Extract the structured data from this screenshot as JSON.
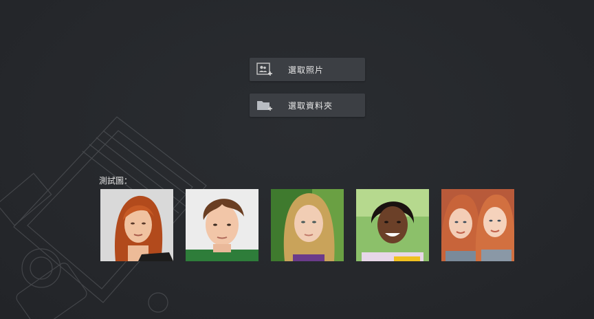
{
  "actions": {
    "select_photos_label": "選取照片",
    "select_folder_label": "選取資料夾"
  },
  "test_images": {
    "label": "測試圖：",
    "items": [
      {
        "icon": "portrait-redhead-woman"
      },
      {
        "icon": "portrait-brown-hair-boy"
      },
      {
        "icon": "portrait-blonde-girl"
      },
      {
        "icon": "portrait-smiling-girl"
      },
      {
        "icon": "portrait-twin-girls"
      }
    ]
  },
  "colors": {
    "background": "#26282c",
    "button_bg": "#3c3f44",
    "text": "#e8e8e8"
  }
}
